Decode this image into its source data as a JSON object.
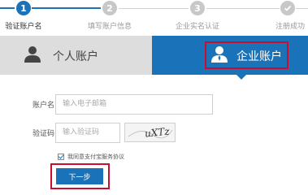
{
  "steps": [
    {
      "number": "1",
      "label": "验证账户名"
    },
    {
      "number": "2",
      "label": "填写账户信息"
    },
    {
      "number": "3",
      "label": "企业实名认证"
    },
    {
      "number": "",
      "label": "注册成功"
    }
  ],
  "tabs": {
    "personal": "个人账户",
    "business": "企业账户"
  },
  "form": {
    "account_label": "账户名",
    "account_placeholder": "输入电子邮箱",
    "captcha_label": "验证码",
    "captcha_placeholder": "输入验证码",
    "captcha_image_text": "uXTz",
    "agree_text": "我同意",
    "agree_link": "支付宝服务协议",
    "next_button": "下一步"
  },
  "colors": {
    "accent": "#1a73b8",
    "highlight": "#c8102e",
    "inactive_tab": "#dddddd"
  }
}
